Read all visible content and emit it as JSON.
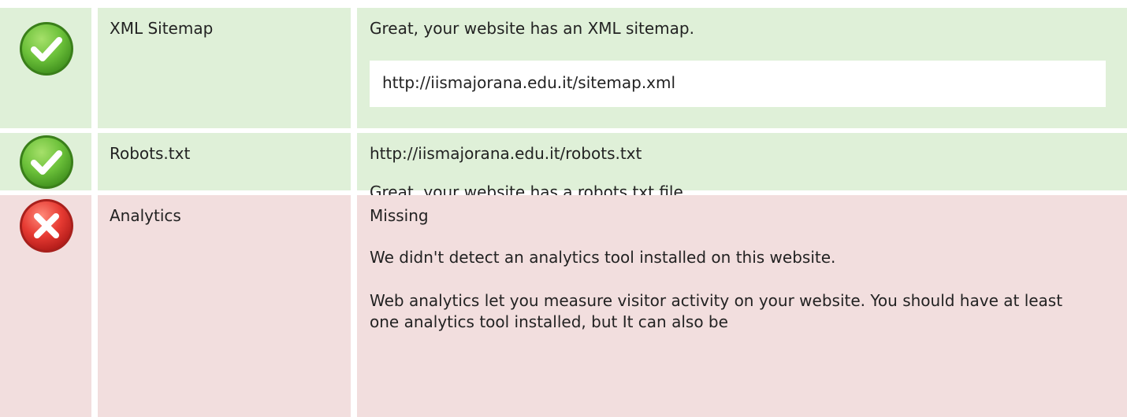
{
  "rows": [
    {
      "status": "pass",
      "status_icon": "check-circle-icon",
      "label": "XML Sitemap",
      "message": "Great, your website has an XML sitemap.",
      "url": "http://iismajorana.edu.it/sitemap.xml"
    },
    {
      "status": "pass",
      "status_icon": "check-circle-icon",
      "label": "Robots.txt",
      "url": "http://iismajorana.edu.it/robots.txt",
      "message": "Great, your website has a robots.txt file."
    },
    {
      "status": "fail",
      "status_icon": "cross-circle-icon",
      "label": "Analytics",
      "value": "Missing",
      "message": "We didn't detect an analytics tool installed on this website.",
      "description": "Web analytics let you measure visitor activity on your website. You should have at least one analytics tool installed, but It can also be"
    }
  ],
  "colors": {
    "pass_background": "#dff0d8",
    "fail_background": "#f2dede",
    "pass_icon": "#5cb531",
    "fail_icon": "#e02f2f"
  }
}
